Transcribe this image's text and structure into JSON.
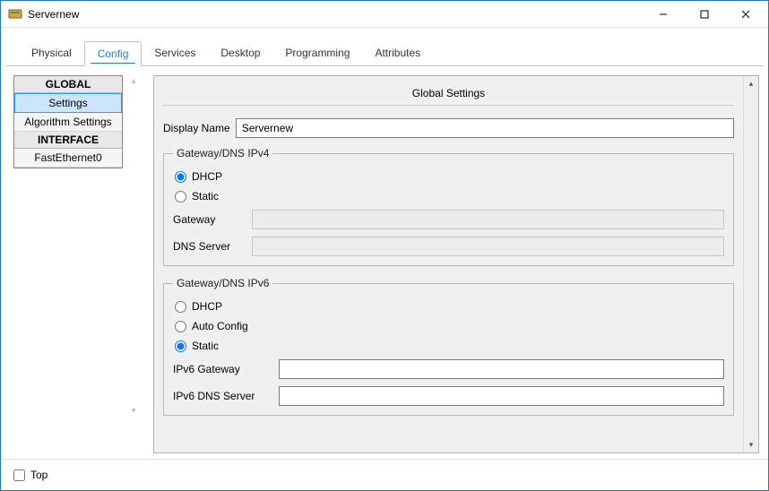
{
  "window": {
    "title": "Servernew"
  },
  "tabs": {
    "physical": "Physical",
    "config": "Config",
    "services": "Services",
    "desktop": "Desktop",
    "programming": "Programming",
    "attributes": "Attributes"
  },
  "sidebar": {
    "global_header": "GLOBAL",
    "settings": "Settings",
    "algorithm_settings": "Algorithm Settings",
    "interface_header": "INTERFACE",
    "fastethernet0": "FastEthernet0"
  },
  "panel": {
    "title": "Global Settings",
    "display_name_label": "Display Name",
    "display_name_value": "Servernew",
    "ipv4": {
      "legend": "Gateway/DNS IPv4",
      "dhcp": "DHCP",
      "static": "Static",
      "gateway_label": "Gateway",
      "gateway_value": "",
      "dns_label": "DNS Server",
      "dns_value": ""
    },
    "ipv6": {
      "legend": "Gateway/DNS IPv6",
      "dhcp": "DHCP",
      "auto": "Auto Config",
      "static": "Static",
      "gateway_label": "IPv6 Gateway",
      "gateway_value": "",
      "dns_label": "IPv6 DNS Server",
      "dns_value": ""
    }
  },
  "footer": {
    "top_label": "Top"
  }
}
